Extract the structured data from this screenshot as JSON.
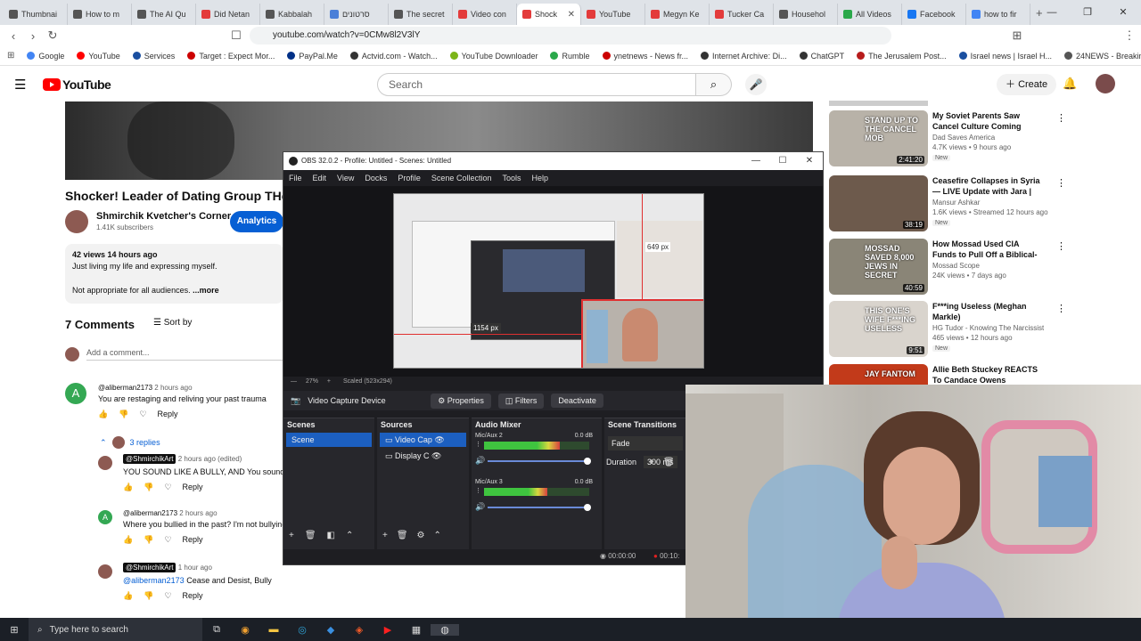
{
  "browser": {
    "tabs": [
      {
        "label": "Thumbnai",
        "color": "#555555"
      },
      {
        "label": "How to m",
        "color": "#555555"
      },
      {
        "label": "The AI Qu",
        "color": "#555555"
      },
      {
        "label": "Did Netan",
        "color": "#e33b3b"
      },
      {
        "label": "Kabbalah",
        "color": "#555555"
      },
      {
        "label": "סרטונים",
        "color": "#4a7fd8"
      },
      {
        "label": "The secret",
        "color": "#555555"
      },
      {
        "label": "Video con",
        "color": "#e33b3b"
      },
      {
        "label": "Shock",
        "color": "#e33b3b",
        "active": true
      },
      {
        "label": "YouTube",
        "color": "#e33b3b"
      },
      {
        "label": "Megyn Ke",
        "color": "#e33b3b"
      },
      {
        "label": "Tucker Ca",
        "color": "#e33b3b"
      },
      {
        "label": "Househol",
        "color": "#555555"
      },
      {
        "label": "All Videos",
        "color": "#2aa84a"
      },
      {
        "label": "Facebook",
        "color": "#1877f2"
      },
      {
        "label": "how to fir",
        "color": "#4285f4"
      }
    ],
    "url": "youtube.com/watch?v=0CMw8l2V3lY",
    "bookmarks": [
      {
        "label": "Google",
        "color": "#4285f4"
      },
      {
        "label": "YouTube",
        "color": "#ff0000"
      },
      {
        "label": "Services",
        "color": "#1a4fa0"
      },
      {
        "label": "Target : Expect Mor...",
        "color": "#cc0000"
      },
      {
        "label": "PayPal.Me",
        "color": "#003087"
      },
      {
        "label": "Actvid.com - Watch...",
        "color": "#333333"
      },
      {
        "label": "YouTube Downloader",
        "color": "#7cb518"
      },
      {
        "label": "Rumble",
        "color": "#2aa84a"
      },
      {
        "label": "ynetnews - News fr...",
        "color": "#cc0000"
      },
      {
        "label": "Internet Archive: Di...",
        "color": "#333333"
      },
      {
        "label": "ChatGPT",
        "color": "#333333"
      },
      {
        "label": "The Jerusalem Post...",
        "color": "#b71c1c"
      },
      {
        "label": "Israel news | Israel H...",
        "color": "#1a4fa0"
      },
      {
        "label": "24NEWS - Breaking...",
        "color": "#555555"
      }
    ]
  },
  "youtube": {
    "logo": "YouTube",
    "search_placeholder": "Search",
    "create_label": "Create",
    "video_title": "Shocker! Leader of Dating Group THe Che",
    "channel_name": "Shmirchik Kvetcher's Corner",
    "subscribers": "1.41K subscribers",
    "analytics_label": "Analytics",
    "description": {
      "stats": "42 views  14 hours ago",
      "line1": "Just living my life and expressing myself.",
      "line2": "Not appropriate for all audiences.",
      "more": "...more"
    },
    "comments_header": "7 Comments",
    "sort_label": "Sort by",
    "add_comment": "Add a comment...",
    "comments": [
      {
        "author": "@aliberman2173",
        "time": "2 hours ago",
        "text": "You are restaging and reliving your past trauma",
        "reply": "Reply",
        "initial": "A"
      },
      {
        "replies_label": "3 replies"
      },
      {
        "author": "@ShmirchikArt",
        "time": "2 hours ago (edited)",
        "text": "YOU SOUND LIKE A BULLY, AND You sound",
        "reply": "Reply"
      },
      {
        "author": "@aliberman2173",
        "time": "2 hours ago",
        "text": "Where you bullied in the past? I'm not bullying",
        "reply": "Reply",
        "initial": "A"
      },
      {
        "author": "@ShmirchikArt",
        "time": "1 hour ago",
        "text_mention": "@aliberman2173",
        "text": "Cease and Desist, Bully",
        "reply": "Reply"
      }
    ],
    "recommendations": [
      {
        "title": "My Soviet Parents Saw Cancel Culture Coming Before Anyon...",
        "channel": "Dad Saves America",
        "meta": "4.7K views • 9 hours ago",
        "badge": "New",
        "duration": "2:41:20",
        "thumb_text": "STAND UP TO THE CANCEL MOB",
        "thumb_color": "#b8b2a8"
      },
      {
        "title": "Ceasefire Collapses in Syria — LIVE Update with Jara | Three ...",
        "channel": "Mansur Ashkar",
        "meta": "1.6K views • Streamed 12 hours ago",
        "badge": "New",
        "duration": "38:19",
        "thumb_text": "",
        "thumb_color": "#6d5a4c"
      },
      {
        "title": "How Mossad Used CIA Funds to Pull Off a Biblical-Scale Airlift",
        "channel": "Mossad Scope",
        "meta": "24K views • 7 days ago",
        "badge": "",
        "duration": "40:59",
        "thumb_text": "MOSSAD SAVED 8,000 JEWS IN SECRET",
        "thumb_color": "#8a8577"
      },
      {
        "title": "F***ing Useless (Meghan Markle)",
        "channel": "HG Tudor - Knowing The Narcissist - Ultra",
        "meta": "465 views • 12 hours ago",
        "badge": "New",
        "duration": "9:51",
        "thumb_text": "THIS ONE'S WIFE F***ING USELESS",
        "thumb_color": "#d9d4cd"
      },
      {
        "title": "Allie Beth Stuckey REACTS To Candace Owens ATTACKING...",
        "channel": "",
        "meta": "",
        "badge": "",
        "duration": "",
        "thumb_text": "JAY FANTOM",
        "thumb_color": "#c23a1a"
      }
    ]
  },
  "obs": {
    "title": "OBS 32.0.2 - Profile: Untitled - Scenes: Untitled",
    "menu": [
      "File",
      "Edit",
      "View",
      "Docks",
      "Profile",
      "Scene Collection",
      "Tools",
      "Help"
    ],
    "canvas_label": "1154 px",
    "canvas_label2": "649 px",
    "zoom": "27%",
    "scaled": "Scaled (523x294)",
    "source_name": "Video Capture Device",
    "btn_properties": "Properties",
    "btn_filters": "Filters",
    "btn_deactivate": "Deactivate",
    "scenes_header": "Scenes",
    "scene_item": "Scene",
    "sources_header": "Sources",
    "sources": [
      "Video Cap",
      "Display C"
    ],
    "mixer_header": "Audio Mixer",
    "mixer": [
      {
        "name": "Mic/Aux 2",
        "db": "0.0 dB",
        "level": 0.72
      },
      {
        "name": "Mic/Aux 3",
        "db": "0.0 dB",
        "level": 0.6
      }
    ],
    "transitions_header": "Scene Transitions",
    "transition": "Fade",
    "duration_label": "Duration",
    "duration_value": "300 ms",
    "time1": "00:00:00",
    "time2": "00:10:"
  },
  "taskbar": {
    "search_placeholder": "Type here to search"
  }
}
